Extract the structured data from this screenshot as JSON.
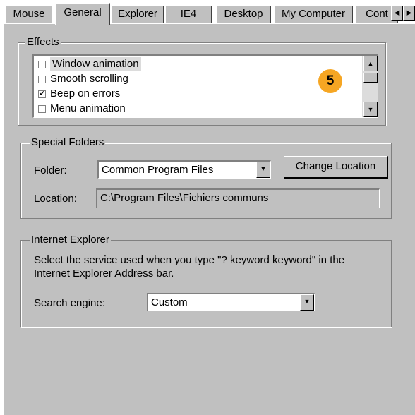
{
  "tabs": [
    {
      "label": "Mouse",
      "active": false
    },
    {
      "label": "General",
      "active": true
    },
    {
      "label": "Explorer",
      "active": false
    },
    {
      "label": "IE4",
      "active": false
    },
    {
      "label": "Desktop",
      "active": false
    },
    {
      "label": "My Computer",
      "active": false
    },
    {
      "label": "Cont",
      "active": false
    }
  ],
  "effects": {
    "title": "Effects",
    "items": [
      {
        "label": "Window animation",
        "checked": false,
        "mark": "",
        "selected": true
      },
      {
        "label": "Smooth scrolling",
        "checked": false,
        "mark": ""
      },
      {
        "label": "Beep on errors",
        "checked": true,
        "mark": "✔"
      },
      {
        "label": "Menu animation",
        "checked": false,
        "mark": ""
      }
    ]
  },
  "special_folders": {
    "title": "Special Folders",
    "folder_label": "Folder:",
    "folder_value": "Common Program Files",
    "change_button": "Change Location",
    "location_label": "Location:",
    "location_value": "C:\\Program Files\\Fichiers communs"
  },
  "internet_explorer": {
    "title": "Internet Explorer",
    "description_line1": "Select the service used when you type \"? keyword keyword\" in the",
    "description_line2": "Internet Explorer Address bar.",
    "search_label": "Search engine:",
    "search_value": "Custom"
  },
  "callout": {
    "number": "5",
    "color": "#f6a623"
  }
}
